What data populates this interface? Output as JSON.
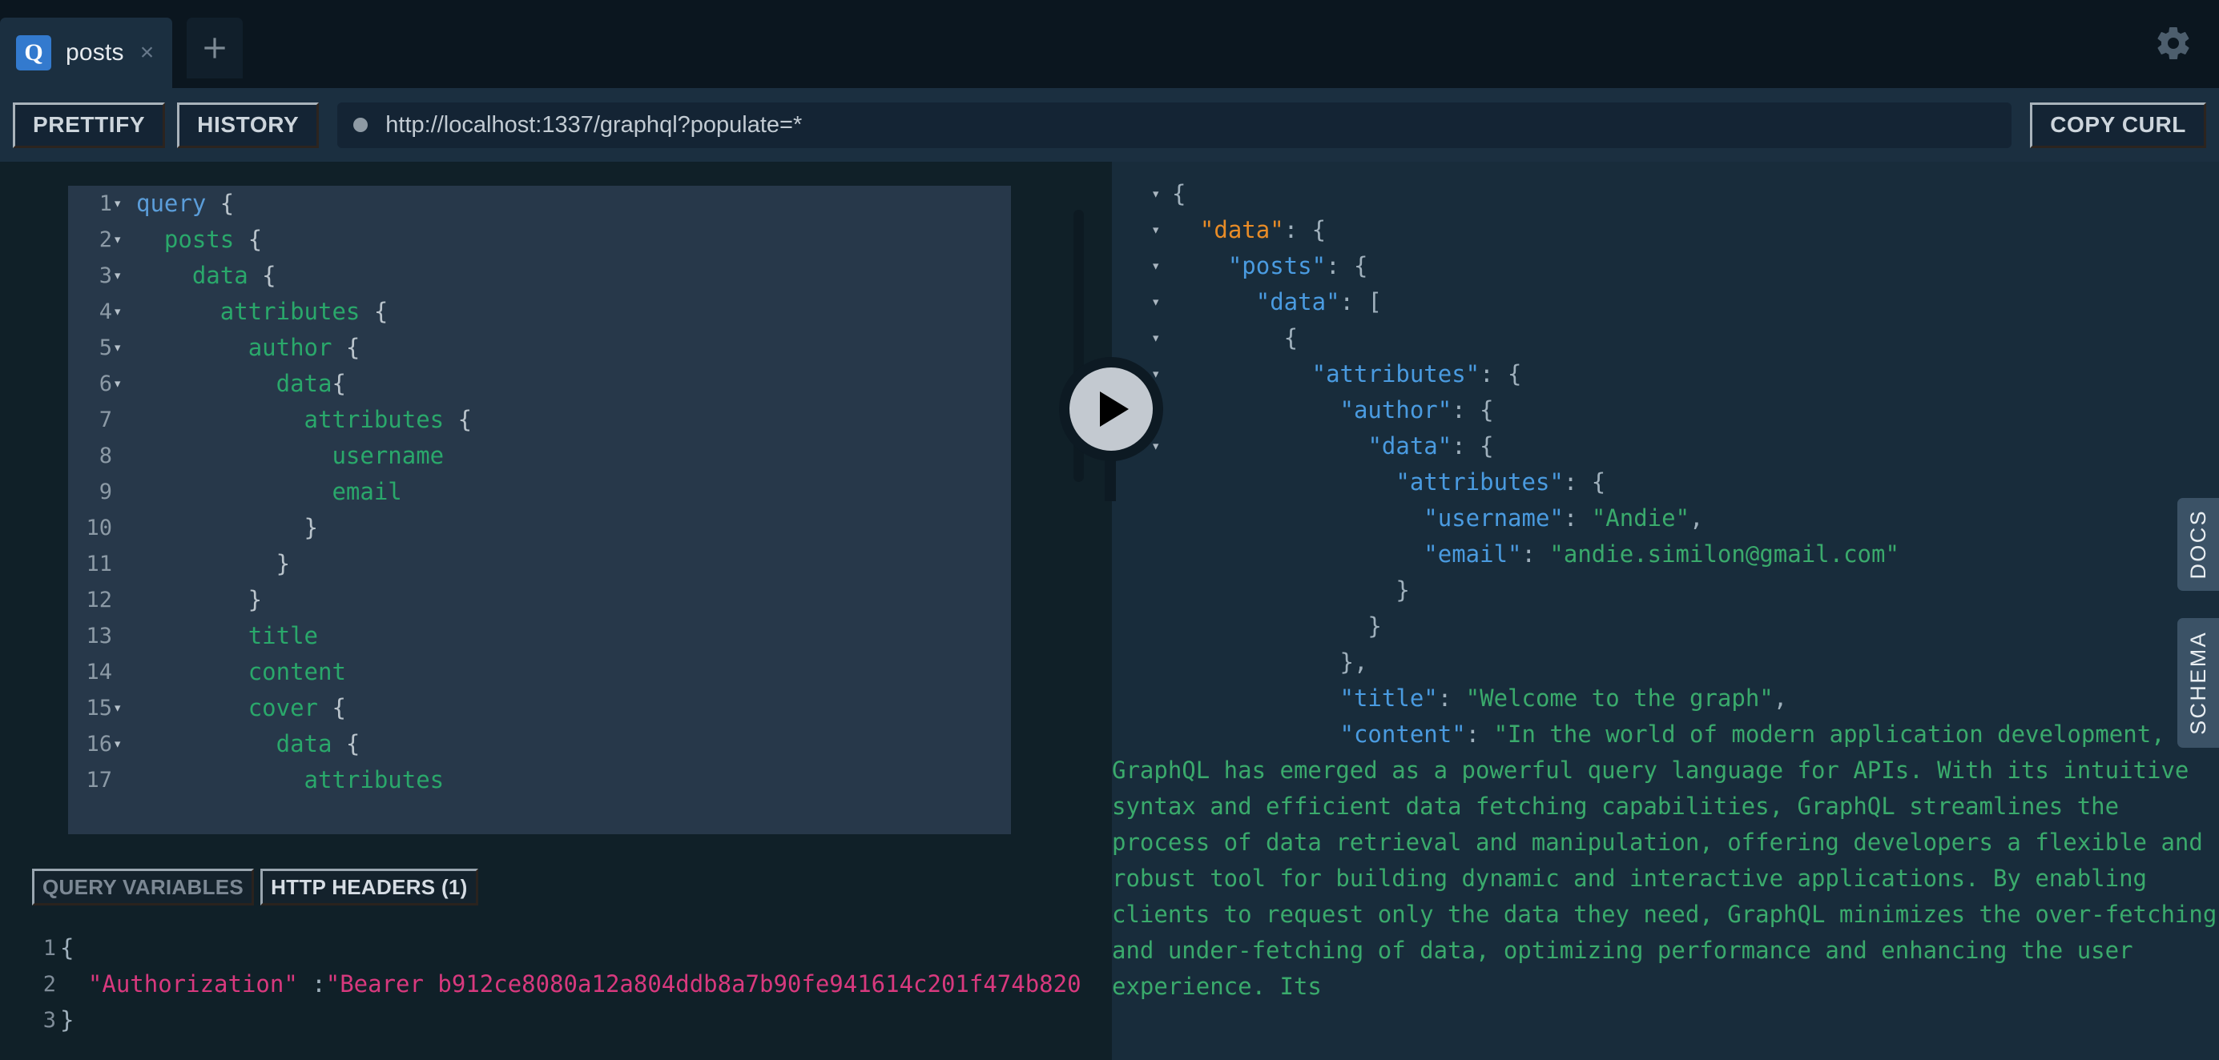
{
  "window": {
    "tab": {
      "badge": "Q",
      "label": "posts",
      "close": "×"
    },
    "new_tab_icon": "plus-icon",
    "settings_icon": "gear-icon"
  },
  "toolbar": {
    "prettify_label": "PRETTIFY",
    "history_label": "HISTORY",
    "copy_curl_label": "COPY CURL",
    "url": "http://localhost:1337/graphql?populate=*"
  },
  "execute_button": {
    "icon": "play-icon",
    "label": ""
  },
  "query_editor": {
    "lines": [
      {
        "n": "1",
        "fold": "▾",
        "segments": [
          {
            "t": "query",
            "c": "k-query"
          },
          {
            "t": " {",
            "c": "k-punct"
          }
        ]
      },
      {
        "n": "2",
        "fold": "▾",
        "segments": [
          {
            "t": "  ",
            "c": "k-punct"
          },
          {
            "t": "posts",
            "c": "k-field"
          },
          {
            "t": " {",
            "c": "k-punct"
          }
        ]
      },
      {
        "n": "3",
        "fold": "▾",
        "segments": [
          {
            "t": "    ",
            "c": "k-punct"
          },
          {
            "t": "data",
            "c": "k-field"
          },
          {
            "t": " {",
            "c": "k-punct"
          }
        ]
      },
      {
        "n": "4",
        "fold": "▾",
        "segments": [
          {
            "t": "      ",
            "c": "k-punct"
          },
          {
            "t": "attributes",
            "c": "k-field"
          },
          {
            "t": " {",
            "c": "k-punct"
          }
        ]
      },
      {
        "n": "5",
        "fold": "▾",
        "segments": [
          {
            "t": "        ",
            "c": "k-punct"
          },
          {
            "t": "author",
            "c": "k-field"
          },
          {
            "t": " {",
            "c": "k-punct"
          }
        ]
      },
      {
        "n": "6",
        "fold": "▾",
        "segments": [
          {
            "t": "          ",
            "c": "k-punct"
          },
          {
            "t": "data",
            "c": "k-field"
          },
          {
            "t": "{",
            "c": "k-punct"
          }
        ]
      },
      {
        "n": "7",
        "fold": "",
        "segments": [
          {
            "t": "            ",
            "c": "k-punct"
          },
          {
            "t": "attributes",
            "c": "k-field"
          },
          {
            "t": " {",
            "c": "k-punct"
          }
        ]
      },
      {
        "n": "8",
        "fold": "",
        "segments": [
          {
            "t": "              ",
            "c": "k-punct"
          },
          {
            "t": "username",
            "c": "k-field"
          }
        ]
      },
      {
        "n": "9",
        "fold": "",
        "segments": [
          {
            "t": "              ",
            "c": "k-punct"
          },
          {
            "t": "email",
            "c": "k-field"
          }
        ]
      },
      {
        "n": "10",
        "fold": "",
        "segments": [
          {
            "t": "            }",
            "c": "k-punct"
          }
        ]
      },
      {
        "n": "11",
        "fold": "",
        "segments": [
          {
            "t": "          }",
            "c": "k-punct"
          }
        ]
      },
      {
        "n": "12",
        "fold": "",
        "segments": [
          {
            "t": "        }",
            "c": "k-punct"
          }
        ]
      },
      {
        "n": "13",
        "fold": "",
        "segments": [
          {
            "t": "        ",
            "c": "k-punct"
          },
          {
            "t": "title",
            "c": "k-field"
          }
        ]
      },
      {
        "n": "14",
        "fold": "",
        "segments": [
          {
            "t": "        ",
            "c": "k-punct"
          },
          {
            "t": "content",
            "c": "k-field"
          }
        ]
      },
      {
        "n": "15",
        "fold": "▾",
        "segments": [
          {
            "t": "        ",
            "c": "k-punct"
          },
          {
            "t": "cover",
            "c": "k-field"
          },
          {
            "t": " {",
            "c": "k-punct"
          }
        ]
      },
      {
        "n": "16",
        "fold": "▾",
        "segments": [
          {
            "t": "          ",
            "c": "k-punct"
          },
          {
            "t": "data",
            "c": "k-field"
          },
          {
            "t": " {",
            "c": "k-punct"
          }
        ]
      },
      {
        "n": "17",
        "fold": "",
        "segments": [
          {
            "t": "            ",
            "c": "k-punct"
          },
          {
            "t": "attributes",
            "c": "k-field"
          }
        ]
      }
    ]
  },
  "bottom_tabs": {
    "query_variables_label": "QUERY VARIABLES",
    "http_headers_label": "HTTP HEADERS (1)",
    "active": "http_headers"
  },
  "headers_editor": {
    "lines": [
      {
        "n": "1",
        "segments": [
          {
            "t": "{",
            "c": "j-punct"
          }
        ]
      },
      {
        "n": "2",
        "segments": [
          {
            "t": "  ",
            "c": "j-punct"
          },
          {
            "t": "\"Authorization\"",
            "c": "j-str"
          },
          {
            "t": " :",
            "c": "j-punct"
          },
          {
            "t": "\"Bearer b912ce8080a12a804ddb8a7b90fe941614c201f474b820",
            "c": "j-str"
          }
        ]
      },
      {
        "n": "3",
        "segments": [
          {
            "t": "}",
            "c": "j-punct"
          }
        ]
      }
    ]
  },
  "response": {
    "lines": [
      {
        "fold": "▾",
        "segments": [
          {
            "t": "{",
            "c": "r-punct"
          }
        ]
      },
      {
        "fold": "▾",
        "segments": [
          {
            "t": "  ",
            "c": "r-punct"
          },
          {
            "t": "\"data\"",
            "c": "r-key-root"
          },
          {
            "t": ": {",
            "c": "r-punct"
          }
        ]
      },
      {
        "fold": "▾",
        "segments": [
          {
            "t": "    ",
            "c": "r-punct"
          },
          {
            "t": "\"posts\"",
            "c": "r-key"
          },
          {
            "t": ": {",
            "c": "r-punct"
          }
        ]
      },
      {
        "fold": "▾",
        "segments": [
          {
            "t": "      ",
            "c": "r-punct"
          },
          {
            "t": "\"data\"",
            "c": "r-key"
          },
          {
            "t": ": [",
            "c": "r-punct"
          }
        ]
      },
      {
        "fold": "▾",
        "segments": [
          {
            "t": "        {",
            "c": "r-punct"
          }
        ]
      },
      {
        "fold": "▾",
        "segments": [
          {
            "t": "          ",
            "c": "r-punct"
          },
          {
            "t": "\"attributes\"",
            "c": "r-key"
          },
          {
            "t": ": {",
            "c": "r-punct"
          }
        ]
      },
      {
        "fold": "▾",
        "segments": [
          {
            "t": "            ",
            "c": "r-punct"
          },
          {
            "t": "\"author\"",
            "c": "r-key"
          },
          {
            "t": ": {",
            "c": "r-punct"
          }
        ]
      },
      {
        "fold": "▾",
        "segments": [
          {
            "t": "              ",
            "c": "r-punct"
          },
          {
            "t": "\"data\"",
            "c": "r-key"
          },
          {
            "t": ": {",
            "c": "r-punct"
          }
        ]
      },
      {
        "fold": "",
        "segments": [
          {
            "t": "                ",
            "c": "r-punct"
          },
          {
            "t": "\"attributes\"",
            "c": "r-key"
          },
          {
            "t": ": {",
            "c": "r-punct"
          }
        ]
      },
      {
        "fold": "",
        "segments": [
          {
            "t": "                  ",
            "c": "r-punct"
          },
          {
            "t": "\"username\"",
            "c": "r-key"
          },
          {
            "t": ": ",
            "c": "r-punct"
          },
          {
            "t": "\"Andie\"",
            "c": "r-val"
          },
          {
            "t": ",",
            "c": "r-punct"
          }
        ]
      },
      {
        "fold": "",
        "segments": [
          {
            "t": "                  ",
            "c": "r-punct"
          },
          {
            "t": "\"email\"",
            "c": "r-key"
          },
          {
            "t": ": ",
            "c": "r-punct"
          },
          {
            "t": "\"andie.similon@gmail.com\"",
            "c": "r-val"
          }
        ]
      },
      {
        "fold": "",
        "segments": [
          {
            "t": "                }",
            "c": "r-punct"
          }
        ]
      },
      {
        "fold": "",
        "segments": [
          {
            "t": "              }",
            "c": "r-punct"
          }
        ]
      },
      {
        "fold": "",
        "segments": [
          {
            "t": "            },",
            "c": "r-punct"
          }
        ]
      },
      {
        "fold": "",
        "segments": [
          {
            "t": "            ",
            "c": "r-punct"
          },
          {
            "t": "\"title\"",
            "c": "r-key"
          },
          {
            "t": ": ",
            "c": "r-punct"
          },
          {
            "t": "\"Welcome to the graph\"",
            "c": "r-val"
          },
          {
            "t": ",",
            "c": "r-punct"
          }
        ]
      },
      {
        "fold": "",
        "wrap": true,
        "segments": [
          {
            "t": "            ",
            "c": "r-punct"
          },
          {
            "t": "\"content\"",
            "c": "r-key"
          },
          {
            "t": ": ",
            "c": "r-punct"
          },
          {
            "t": "\"In the world of modern application development, GraphQL has emerged as a powerful query language for APIs. With its intuitive syntax and efficient data fetching capabilities, GraphQL streamlines the process of data retrieval and manipulation, offering developers a flexible and robust tool for building dynamic and interactive applications. By enabling clients to request only the data they need, GraphQL minimizes the over-fetching and under-fetching of data, optimizing performance and enhancing the user experience. Its",
            "c": "r-val"
          }
        ]
      }
    ]
  },
  "side_tabs": {
    "docs_label": "DOCS",
    "schema_label": "SCHEMA"
  },
  "colors": {
    "accent_blue": "#337ace",
    "key_blue": "#4a9be0",
    "root_key_orange": "#e88c27",
    "string_green": "#3aaa6c",
    "header_pink": "#d8397e",
    "graphql_keyword": "#5b9dd9",
    "panel_bg": "#182c3b",
    "editor_bg": "#27384a",
    "chrome_bg": "#0b1620"
  }
}
